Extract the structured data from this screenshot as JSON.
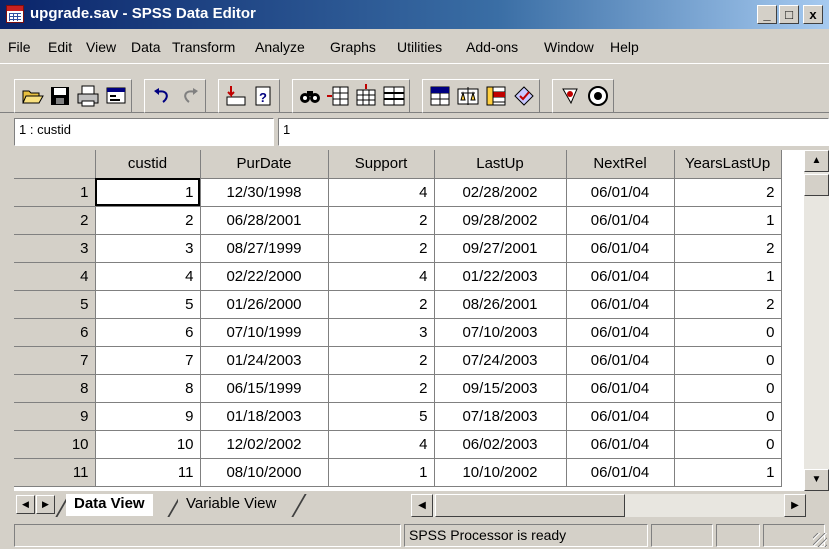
{
  "window": {
    "title": "upgrade.sav - SPSS Data Editor",
    "buttons": [
      "_",
      "□",
      "x"
    ]
  },
  "menu": [
    "File",
    "Edit",
    "View",
    "Data",
    "Transform",
    "Analyze",
    "Graphs",
    "Utilities",
    "Add-ons",
    "Window",
    "Help"
  ],
  "toolbar": {
    "icons": [
      "open-file-icon",
      "save-icon",
      "print-icon",
      "dialog-recall-icon",
      "undo-icon",
      "redo-icon",
      "go-to-case-icon",
      "variables-icon",
      "find-icon",
      "insert-cases-icon",
      "insert-variable-icon",
      "split-file-icon",
      "weight-cases-icon",
      "select-cases-icon",
      "value-labels-icon",
      "use-sets-icon"
    ]
  },
  "cell_editor": {
    "name": "1 : custid",
    "value": "1"
  },
  "grid": {
    "columns": [
      "custid",
      "PurDate",
      "Support",
      "LastUp",
      "NextRel",
      "YearsLastUp"
    ],
    "rows": [
      [
        "1",
        "1",
        "12/30/1998",
        "4",
        "02/28/2002",
        "06/01/04",
        "2"
      ],
      [
        "2",
        "2",
        "06/28/2001",
        "2",
        "09/28/2002",
        "06/01/04",
        "1"
      ],
      [
        "3",
        "3",
        "08/27/1999",
        "2",
        "09/27/2001",
        "06/01/04",
        "2"
      ],
      [
        "4",
        "4",
        "02/22/2000",
        "4",
        "01/22/2003",
        "06/01/04",
        "1"
      ],
      [
        "5",
        "5",
        "01/26/2000",
        "2",
        "08/26/2001",
        "06/01/04",
        "2"
      ],
      [
        "6",
        "6",
        "07/10/1999",
        "3",
        "07/10/2003",
        "06/01/04",
        "0"
      ],
      [
        "7",
        "7",
        "01/24/2003",
        "2",
        "07/24/2003",
        "06/01/04",
        "0"
      ],
      [
        "8",
        "8",
        "06/15/1999",
        "2",
        "09/15/2003",
        "06/01/04",
        "0"
      ],
      [
        "9",
        "9",
        "01/18/2003",
        "5",
        "07/18/2003",
        "06/01/04",
        "0"
      ],
      [
        "10",
        "10",
        "12/02/2002",
        "4",
        "06/02/2003",
        "06/01/04",
        "0"
      ],
      [
        "11",
        "11",
        "08/10/2000",
        "1",
        "10/10/2002",
        "06/01/04",
        "1"
      ]
    ]
  },
  "tabs": {
    "data_view": "Data View",
    "variable_view": "Variable View"
  },
  "status": {
    "processor": "SPSS Processor  is ready"
  },
  "colors": {
    "title_start": "#0a246a",
    "title_end": "#a6caf0",
    "chrome": "#d4d0c8"
  }
}
